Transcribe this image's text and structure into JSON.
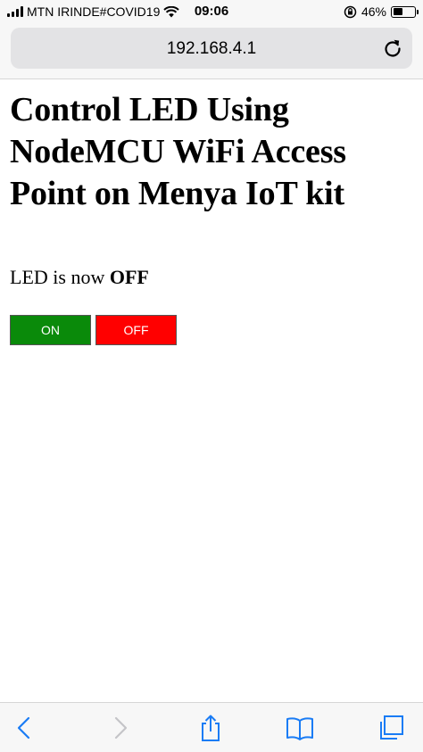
{
  "status_bar": {
    "carrier": "MTN IRINDE#COVID19",
    "time": "09:06",
    "battery_percent": "46%",
    "battery_level": 0.46
  },
  "address_bar": {
    "url": "192.168.4.1"
  },
  "page": {
    "title": "Control LED Using NodeMCU WiFi Access Point on Menya IoT kit",
    "status_prefix": "LED is now",
    "status_value": "OFF",
    "buttons": {
      "on_label": "ON",
      "off_label": "OFF"
    },
    "colors": {
      "on_button": "#0a8a0a",
      "off_button": "#ff0000"
    }
  },
  "toolbar": {
    "icons": [
      "back-icon",
      "forward-icon",
      "share-icon",
      "bookmarks-icon",
      "tabs-icon"
    ]
  }
}
